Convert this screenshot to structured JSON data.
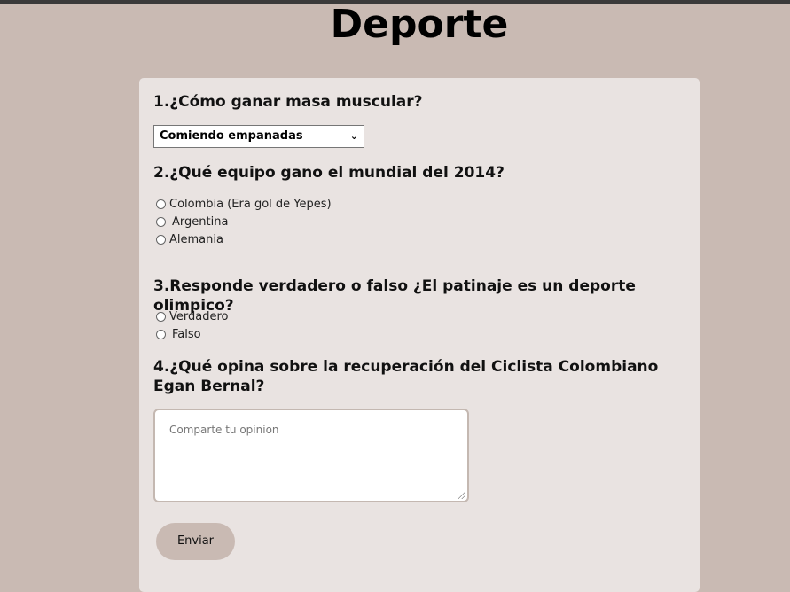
{
  "page": {
    "title": "Deporte"
  },
  "q1": {
    "question": "1.¿Cómo ganar masa muscular?",
    "selected": "Comiendo empanadas"
  },
  "q2": {
    "question": "2.¿Qué equipo gano el mundial del 2014?",
    "options": [
      "Colombia (Era gol de Yepes)",
      "Argentina",
      "Alemania"
    ]
  },
  "q3": {
    "question": "3.Responde verdadero o falso ¿El patinaje es un deporte olimpico?",
    "options": [
      "Verdadero",
      "Falso"
    ]
  },
  "q4": {
    "question": "4.¿Qué opina sobre la recuperación del Ciclista Colombiano Egan Bernal?",
    "placeholder": "Comparte tu opinion"
  },
  "form": {
    "submit_label": "Enviar"
  },
  "colors": {
    "background": "#c9bab3",
    "card": "#e9e3e1",
    "button": "#c9bab3"
  },
  "icons": {
    "select_arrow": "chevron-down-icon"
  }
}
